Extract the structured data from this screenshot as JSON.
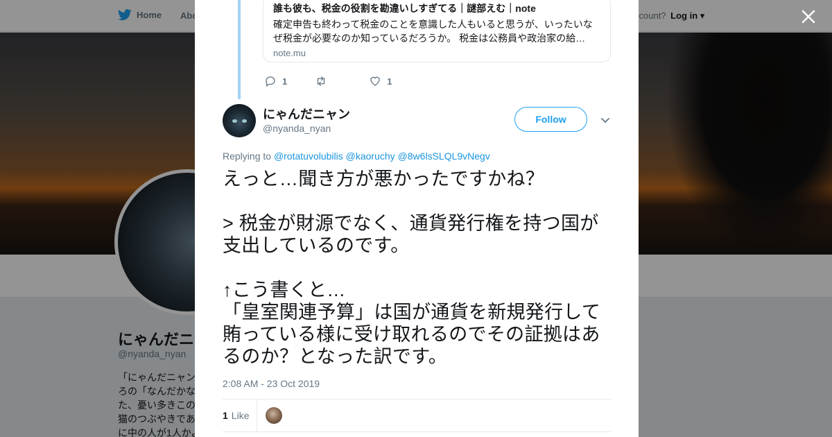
{
  "nav": {
    "home_label": "Home",
    "about_label": "Abo",
    "account_prompt": "ccount?",
    "login_label": "Log in"
  },
  "profile": {
    "name": "にゃんだニ",
    "handle": "@nyanda_nyan",
    "bio_lines": [
      "「にゃんだニャン",
      "ろの「なんだかな",
      "た、憂い多きこの",
      "猫のつぶやきであ",
      "に中の人が1人かよ"
    ]
  },
  "modal": {
    "link_card": {
      "title": "誰も彼も、税金の役割を勘違いしすぎてる｜謎部えむ｜note",
      "description": "確定申告も終わって税金のことを意識した人もいると思うが、いったいなぜ税金が必要なのか知っているだろうか。 税金は公務員や政治家の給…",
      "domain": "note.mu"
    },
    "parent_actions": {
      "reply_count": "1",
      "retweet_count": "",
      "like_count": "1"
    },
    "author": {
      "name": "にゃんだニャン",
      "handle": "@nyanda_nyan",
      "follow_label": "Follow"
    },
    "replying": {
      "prefix": "Replying to",
      "mentions": [
        "@rotatuvolubilis",
        "@kaoruchy",
        "@8w6lsSLQL9vNegv"
      ]
    },
    "tweet_lines": [
      "えっと…聞き方が悪かったですかね？",
      "",
      "> 税金が財源でなく、通貨発行権を持つ国が支出しているのです。",
      "",
      "↑こう書くと…",
      "「皇室関連予算」は国が通貨を新規発行して賄っている様に受け取れるのでその証拠はあるのか？となった訳です。"
    ],
    "timestamp": "2:08 AM - 23 Oct 2019",
    "likes": {
      "count": "1",
      "label": "Like"
    }
  },
  "colors": {
    "brand": "#1da1f2",
    "link": "#1b95e0",
    "thread_line": "#a3d2f4"
  },
  "icons": [
    "twitter-bird-icon",
    "close-icon",
    "reply-icon",
    "retweet-icon",
    "heart-icon",
    "chevron-down-icon"
  ]
}
